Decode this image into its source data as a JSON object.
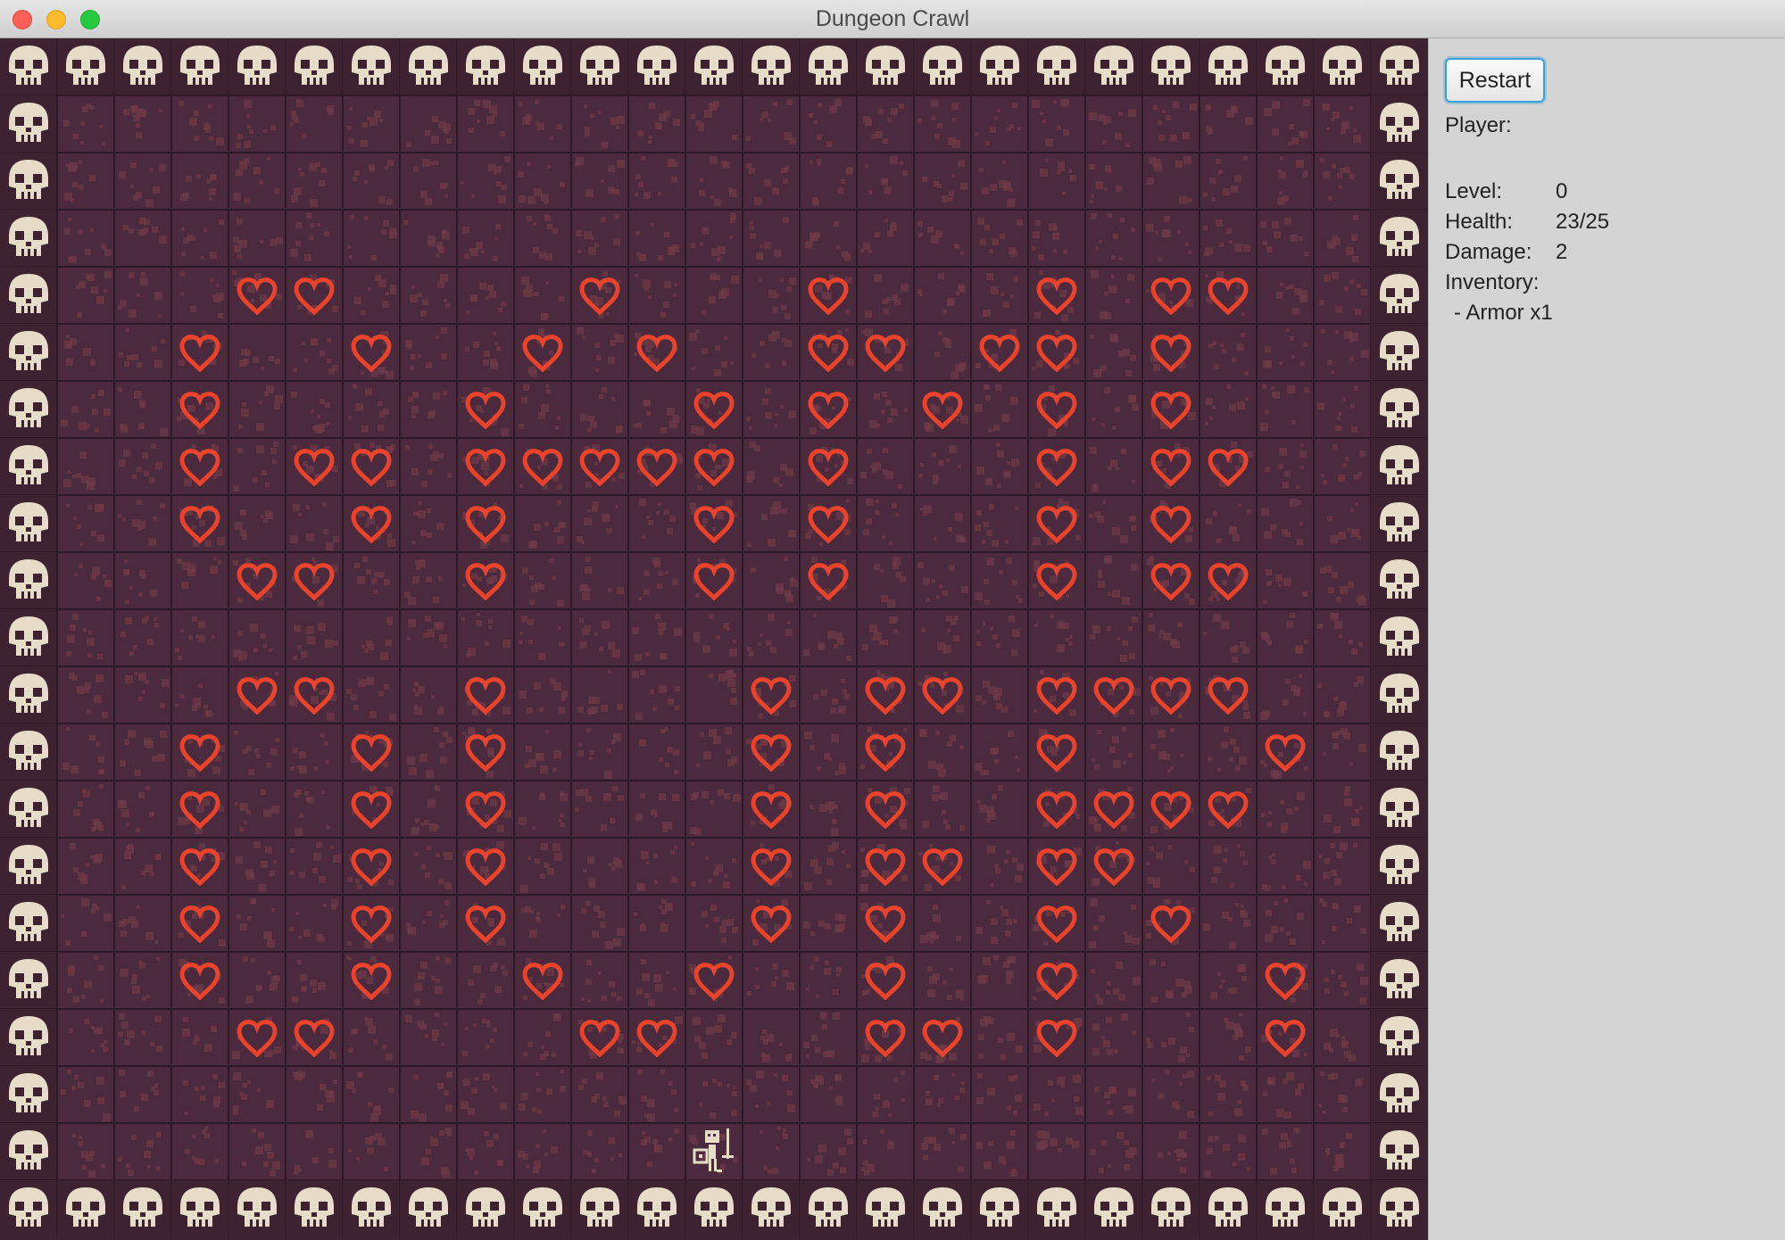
{
  "window": {
    "title": "Dungeon Crawl"
  },
  "panel": {
    "restart_label": "Restart",
    "player_label": "Player:",
    "player_name": "",
    "stats": [
      {
        "label": "Level:",
        "value": "0"
      },
      {
        "label": "Health:",
        "value": "23/25"
      },
      {
        "label": "Damage:",
        "value": "2"
      }
    ],
    "inventory_label": "Inventory:",
    "inventory_items": [
      "- Armor x1"
    ]
  },
  "map": {
    "cols": 25,
    "rows": 21,
    "rows_data": [
      "WWWWWWWWWWWWWWWWWWWWWWWWW",
      "W.......................W",
      "W.......................W",
      "W.......................W",
      "W...HH....H...H...H.HH..W",
      "W..H..H..H.H..HH.HH.H...W",
      "W..H....H...H.H.H.H.H...W",
      "W..H.HH.HHHHH.H...H.HH..W",
      "W..H..H.H...H.H...H.H...W",
      "W...HH..H...H.H...H.HH..W",
      "W.......................W",
      "W...HH..H....H.HH.HHHH..W",
      "W..H..H.H....H.H..H...H.W",
      "W..H..H.H....H.H..HHHH..W",
      "W..H..H.H....H.HH.HH....W",
      "W..H..H.H....H.H..H.H...W",
      "W..H..H..H..H..H..H...H.W",
      "W...HH....HH...HH.H...H.W",
      "W.......................W",
      "W...........P...........W",
      "WWWWWWWWWWWWWWWWWWWWWWWWW"
    ],
    "legend": {
      "W": "skull-wall-icon",
      ".": "floor-tile",
      "H": "heart-icon",
      "P": "player-skeleton-knight-icon"
    },
    "colors": {
      "floor": "#4a2a3c",
      "floor_speckle": "#6e3a48",
      "grid_line": "#2e1826",
      "skull": "#e6dcc8",
      "skull_dark": "#3d2232",
      "heart": "#e8432c",
      "player": "#e6dcc8"
    }
  }
}
